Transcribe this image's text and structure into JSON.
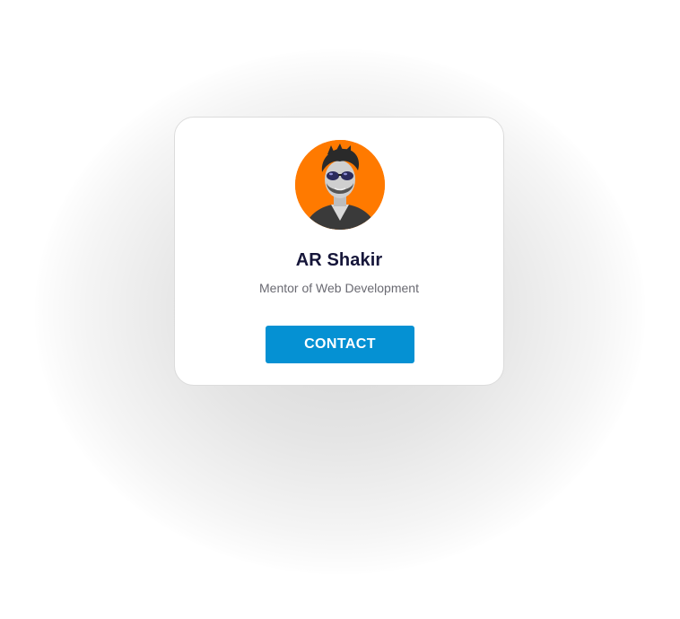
{
  "profile": {
    "name": "AR Shakir",
    "title": "Mentor of Web Development",
    "avatar_icon": "user-photo-avatar",
    "avatar_bg": "#ff7a00"
  },
  "actions": {
    "contact_label": "CONTACT"
  },
  "colors": {
    "accent": "#0591d3",
    "name_text": "#16163a",
    "subtitle_text": "#6a6a72"
  }
}
